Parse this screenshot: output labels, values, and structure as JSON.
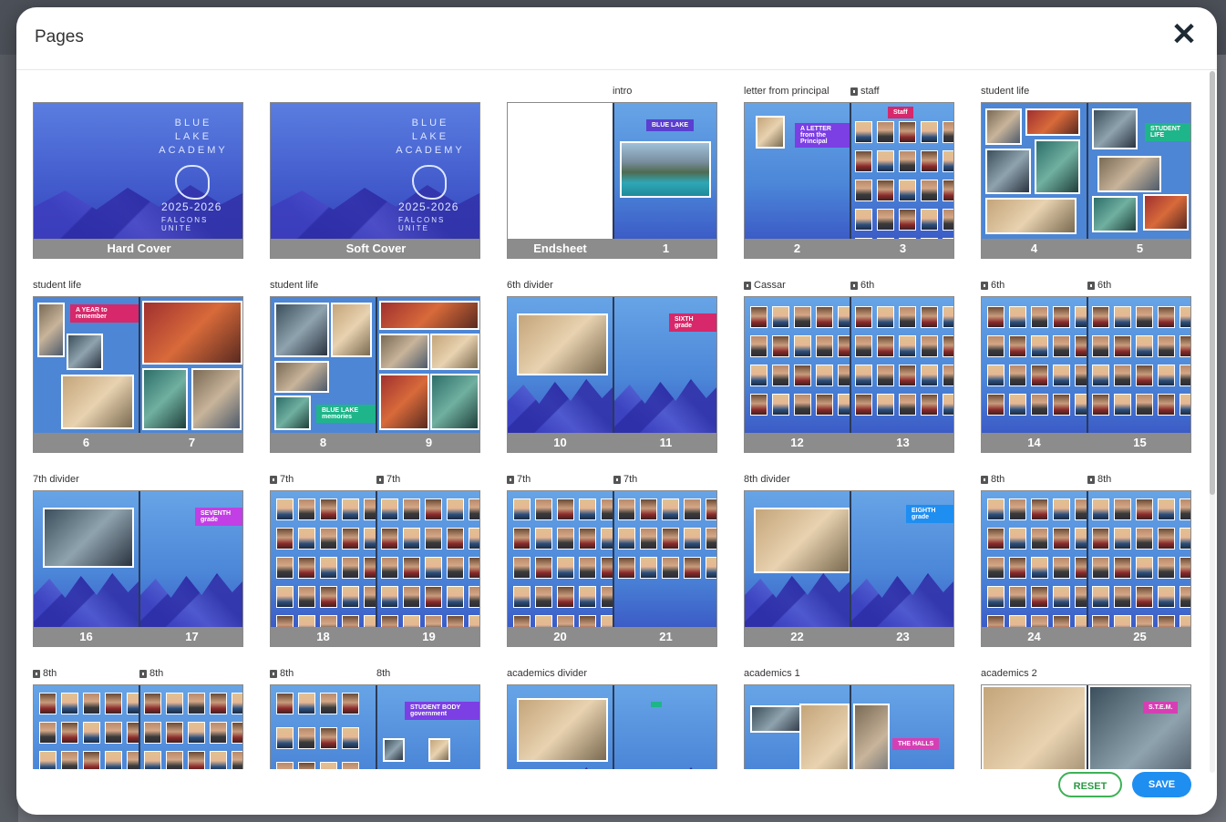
{
  "dialog": {
    "title": "Pages",
    "close_icon": "close-icon",
    "reset_label": "RESET",
    "save_label": "SAVE",
    "accent_save": "#1f8ef1",
    "accent_reset": "#3db155"
  },
  "covers": {
    "hard_cover_label": "Hard Cover",
    "soft_cover_label": "Soft Cover",
    "school_lines": [
      "BLUE",
      "LAKE",
      "ACADEMY"
    ],
    "year": "2025-2026",
    "subtitle": "FALCONS UNITE"
  },
  "rows": [
    [
      {
        "labels": [
          {
            "text": ""
          }
        ],
        "pages": [
          "Hard Cover"
        ]
      },
      {
        "labels": [
          {
            "text": ""
          }
        ],
        "pages": [
          "Soft Cover"
        ]
      },
      {
        "labels": [
          {
            "text": ""
          },
          {
            "text": "intro"
          }
        ],
        "pages": [
          "Endsheet",
          "1"
        ]
      },
      {
        "labels": [
          {
            "text": "letter from principal"
          },
          {
            "text": "staff",
            "locked": true
          }
        ],
        "pages": [
          "2",
          "3"
        ]
      },
      {
        "labels": [
          {
            "text": "student life"
          }
        ],
        "pages": [
          "4",
          "5"
        ]
      }
    ],
    [
      {
        "labels": [
          {
            "text": "student life"
          }
        ],
        "pages": [
          "6",
          "7"
        ]
      },
      {
        "labels": [
          {
            "text": "student life"
          }
        ],
        "pages": [
          "8",
          "9"
        ]
      },
      {
        "labels": [
          {
            "text": "6th divider"
          }
        ],
        "pages": [
          "10",
          "11"
        ]
      },
      {
        "labels": [
          {
            "text": "Cassar",
            "locked": true
          },
          {
            "text": "6th",
            "locked": true
          }
        ],
        "pages": [
          "12",
          "13"
        ]
      },
      {
        "labels": [
          {
            "text": "6th",
            "locked": true
          },
          {
            "text": "6th",
            "locked": true
          }
        ],
        "pages": [
          "14",
          "15"
        ]
      }
    ],
    [
      {
        "labels": [
          {
            "text": "7th divider"
          }
        ],
        "pages": [
          "16",
          "17"
        ]
      },
      {
        "labels": [
          {
            "text": "7th",
            "locked": true
          },
          {
            "text": "7th",
            "locked": true
          }
        ],
        "pages": [
          "18",
          "19"
        ]
      },
      {
        "labels": [
          {
            "text": "7th",
            "locked": true
          },
          {
            "text": "7th",
            "locked": true
          }
        ],
        "pages": [
          "20",
          "21"
        ]
      },
      {
        "labels": [
          {
            "text": "8th divider"
          }
        ],
        "pages": [
          "22",
          "23"
        ]
      },
      {
        "labels": [
          {
            "text": "8th",
            "locked": true
          },
          {
            "text": "8th",
            "locked": true
          }
        ],
        "pages": [
          "24",
          "25"
        ]
      }
    ],
    [
      {
        "labels": [
          {
            "text": "8th",
            "locked": true
          },
          {
            "text": "8th",
            "locked": true
          }
        ],
        "pages": []
      },
      {
        "labels": [
          {
            "text": "8th",
            "locked": true
          },
          {
            "text": "8th"
          }
        ],
        "pages": []
      },
      {
        "labels": [
          {
            "text": "academics divider"
          }
        ],
        "pages": []
      },
      {
        "labels": [
          {
            "text": "academics 1"
          }
        ],
        "pages": []
      },
      {
        "labels": [
          {
            "text": "academics 2"
          }
        ],
        "pages": []
      }
    ]
  ],
  "thumb_text": {
    "intro_banner": "BLUE LAKE",
    "principal_banner": "A LETTER from the Principal",
    "staff_banner": "Staff",
    "student_life_banner": "STUDENT LIFE",
    "year_banner": "A YEAR to remember",
    "memories_banner": "BLUE LAKE memories",
    "sixth_banner": "SIXTH grade",
    "seventh_banner": "SEVENTH grade",
    "eighth_banner": "EIGHTH grade",
    "student_body_banner": "STUDENT BODY government",
    "halls_banner": "THE HALLS",
    "stem_banner": "S.T.E.M."
  }
}
